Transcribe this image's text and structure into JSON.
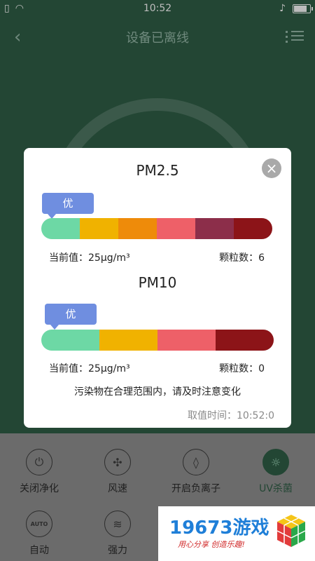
{
  "status_bar": {
    "time": "10:52"
  },
  "app_bar": {
    "title": "设备已离线",
    "back_icon": "chevron-left-icon",
    "menu_icon": "list-menu-icon"
  },
  "controls": [
    {
      "label": "关闭净化",
      "icon": "power-icon"
    },
    {
      "label": "风速",
      "icon": "fan-icon"
    },
    {
      "label": "开启负离子",
      "icon": "drop-icon"
    },
    {
      "label": "UV杀菌",
      "icon": "sun-icon",
      "active": true
    },
    {
      "label": "自动",
      "icon": "auto-icon",
      "icon_text": "AUTO"
    },
    {
      "label": "强力",
      "icon": "wind-icon"
    }
  ],
  "watermark": {
    "brand": "19673游戏",
    "slogan": "用心分享  创造乐趣!"
  },
  "dialog": {
    "close_icon": "close-icon",
    "pm25": {
      "title": "PM2.5",
      "level": "优",
      "current_label": "当前值：25μg/m³",
      "particle_label": "颗粒数：6",
      "segments": [
        "#6dd8a5",
        "#f0b200",
        "#ee8b0a",
        "#ee6068",
        "#8c2e4a",
        "#8c1418"
      ]
    },
    "pm10": {
      "title": "PM10",
      "level": "优",
      "current_label": "当前值：25μg/m³",
      "particle_label": "颗粒数：0",
      "segments": [
        "#6dd8a5",
        "#f0b200",
        "#ee6068",
        "#8c1418"
      ]
    },
    "note": "污染物在合理范围内，请及时注意变化",
    "timestamp": "取值时间：10:52:0"
  }
}
